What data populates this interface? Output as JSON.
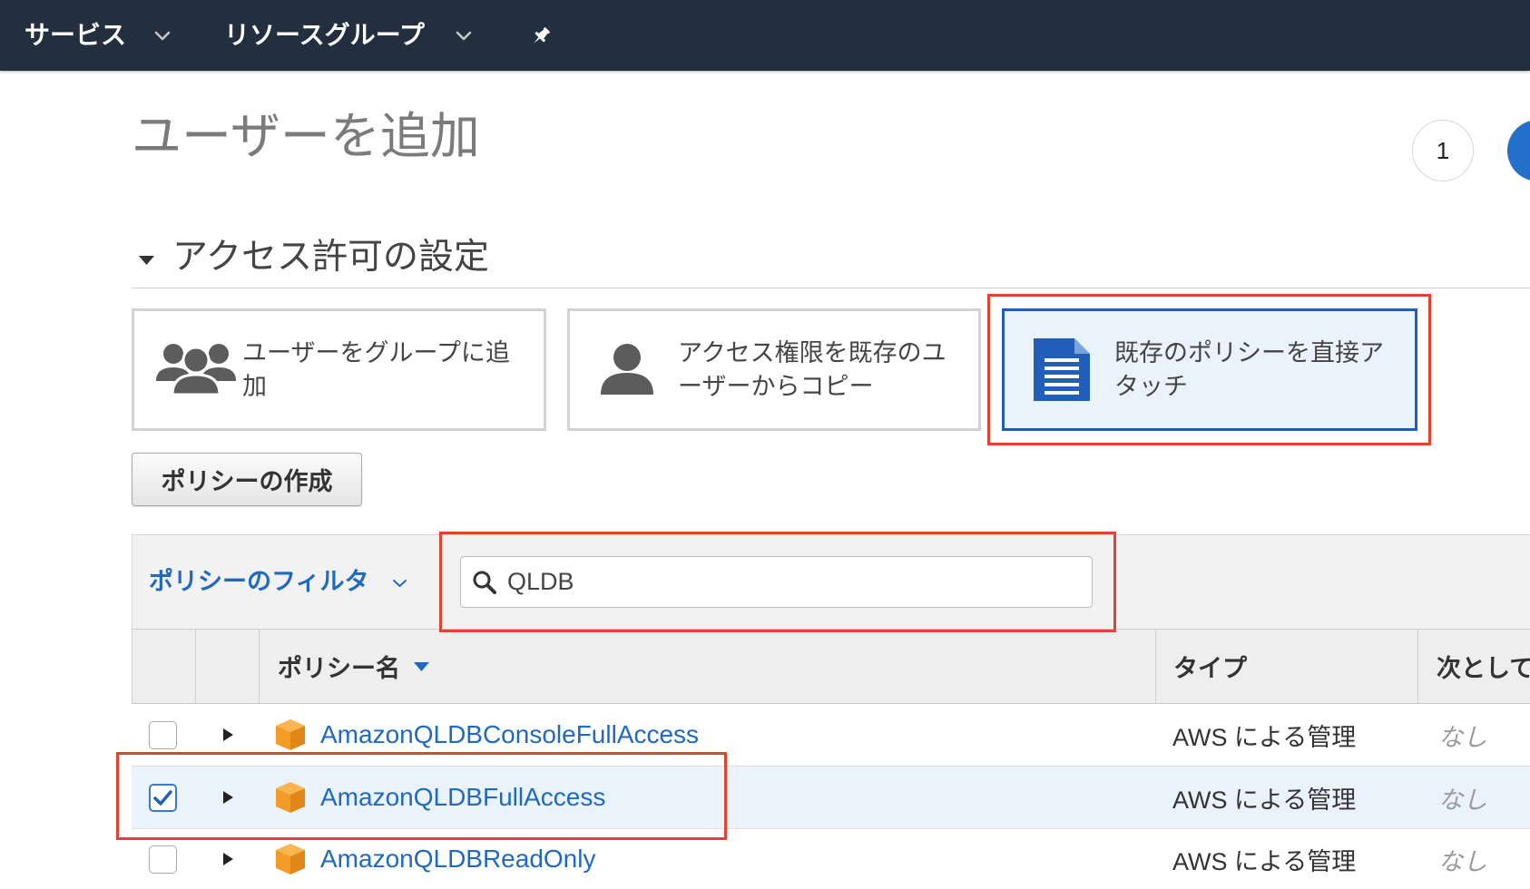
{
  "colors": {
    "nav_bg": "#232f3e",
    "accent_blue": "#1f69c1",
    "selected_bg": "#eaf3fc",
    "selected_border": "#1f5fba",
    "highlight_red": "#e4432b",
    "current_step_blue": "#2270c9",
    "policy_icon_orange": "#f29a2a"
  },
  "nav": {
    "services": {
      "label": "サービス",
      "icon": "chevron-down-icon"
    },
    "resource_groups": {
      "label": "リソースグループ",
      "icon": "chevron-down-icon"
    },
    "pin_icon": "pin-icon"
  },
  "page": {
    "title": "ユーザーを追加"
  },
  "wizard": {
    "step_1_label": "1"
  },
  "permissions": {
    "section_title": "アクセス許可の設定",
    "options": [
      {
        "label_lines": [
          "ユーザーをグループに追",
          "加"
        ],
        "icon": "users-group-icon",
        "selected": false
      },
      {
        "label_lines": [
          "アクセス権限を既存のユ",
          "ーザーからコピー"
        ],
        "icon": "user-icon",
        "selected": false
      },
      {
        "label_lines": [
          "既存のポリシーを直接ア",
          "タッチ"
        ],
        "icon": "policy-document-icon",
        "selected": true
      }
    ],
    "create_policy_button": "ポリシーの作成"
  },
  "policy_filter": {
    "label": "ポリシーのフィルタ",
    "search_value": "QLDB",
    "search_icon": "search-icon"
  },
  "policy_table": {
    "columns": {
      "name": "ポリシー名",
      "type": "タイプ",
      "used_as": "次として"
    },
    "rows": [
      {
        "name": "AmazonQLDBConsoleFullAccess",
        "type": "AWS による管理",
        "used_as": "なし",
        "checked": false
      },
      {
        "name": "AmazonQLDBFullAccess",
        "type": "AWS による管理",
        "used_as": "なし",
        "checked": true
      },
      {
        "name": "AmazonQLDBReadOnly",
        "type": "AWS による管理",
        "used_as": "なし",
        "checked": false
      }
    ]
  }
}
